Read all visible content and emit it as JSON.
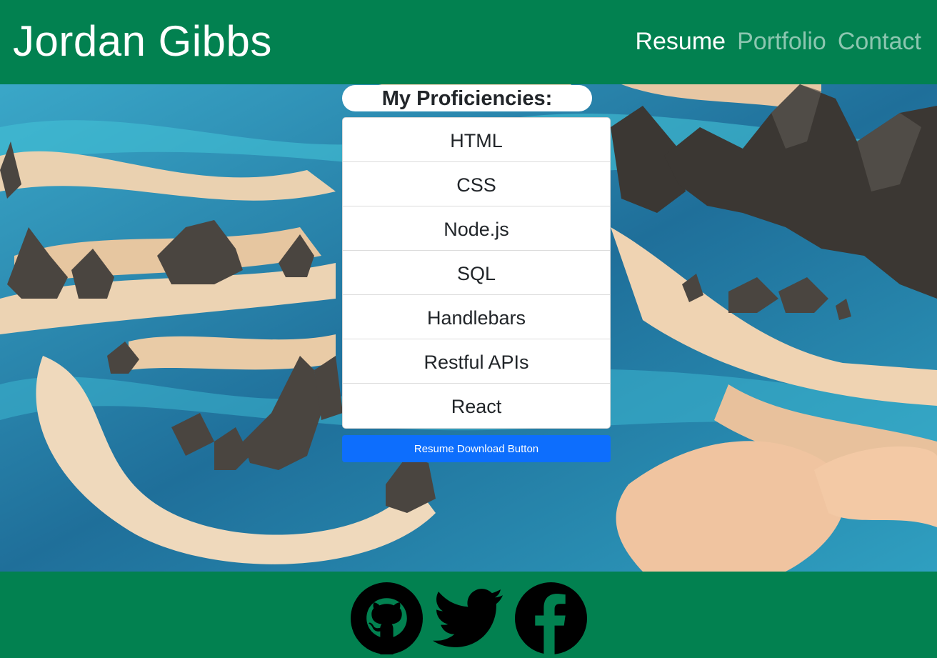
{
  "header": {
    "brand": "Jordan Gibbs",
    "nav": [
      {
        "label": "Resume",
        "active": true
      },
      {
        "label": "Portfolio",
        "active": false
      },
      {
        "label": "Contact",
        "active": false
      }
    ]
  },
  "main": {
    "title": "My Proficiencies:",
    "proficiencies": [
      "HTML",
      "CSS",
      "Node.js",
      "SQL",
      "Handlebars",
      "Restful APIs",
      "React"
    ],
    "download_button": "Resume Download Button"
  },
  "footer": {
    "icons": [
      "github-icon",
      "twitter-icon",
      "facebook-icon"
    ]
  },
  "colors": {
    "brand_green": "#028150",
    "button_blue": "#0d6efd",
    "water": "#2a8fb3",
    "sand": "#e9c9a3"
  }
}
